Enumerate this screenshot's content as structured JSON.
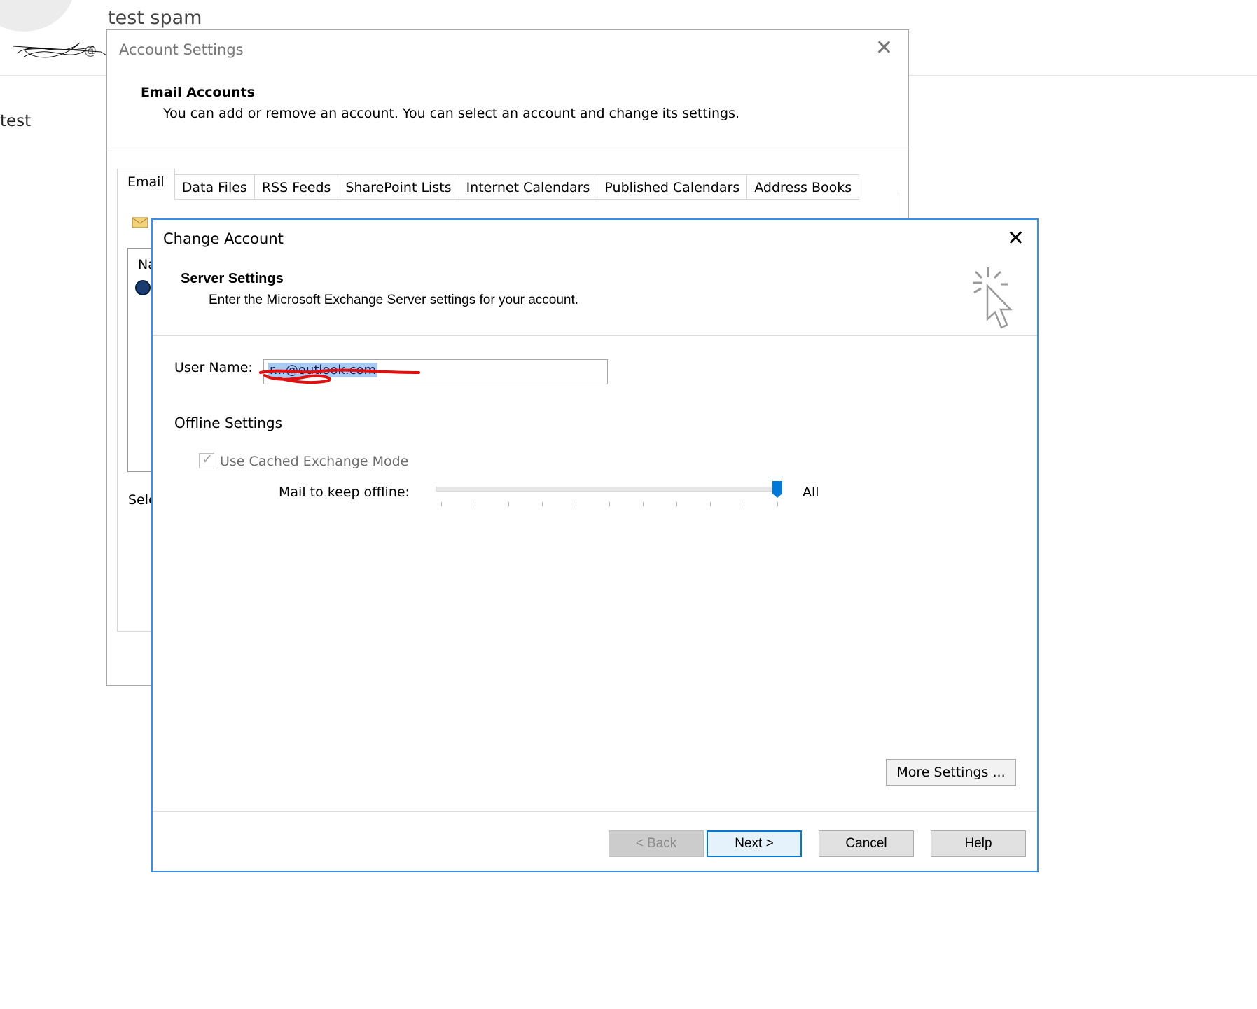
{
  "background_email": {
    "subject": "test spam",
    "from_partial": "@",
    "body_text": "test"
  },
  "account_settings": {
    "title": "Account Settings",
    "heading": "Email Accounts",
    "description": "You can add or remove an account. You can select an account and change its settings.",
    "tabs": [
      {
        "label": "Email"
      },
      {
        "label": "Data Files"
      },
      {
        "label": "RSS Feeds"
      },
      {
        "label": "SharePoint Lists"
      },
      {
        "label": "Internet Calendars"
      },
      {
        "label": "Published Calendars"
      },
      {
        "label": "Address Books"
      }
    ],
    "list_header_partial": "Na",
    "footer_partial": "Sele"
  },
  "change_account": {
    "title": "Change Account",
    "heading": "Server Settings",
    "description": "Enter the Microsoft Exchange Server settings for your account.",
    "user_name_label": "User Name:",
    "user_name_value": "r...@outlook.com",
    "offline_settings_label": "Offline Settings",
    "cached_mode_label": "Use Cached Exchange Mode",
    "cached_mode_checked": true,
    "mail_offline_label": "Mail to keep offline:",
    "mail_offline_value_label": "All",
    "slider_position_fraction": 1.0,
    "more_settings_label": "More Settings ...",
    "buttons": {
      "back": "< Back",
      "next": "Next >",
      "cancel": "Cancel",
      "help": "Help"
    }
  },
  "colors": {
    "accent": "#0078d7",
    "dialog_border": "#3a8ee6",
    "slider_thumb": "#0078d7"
  }
}
